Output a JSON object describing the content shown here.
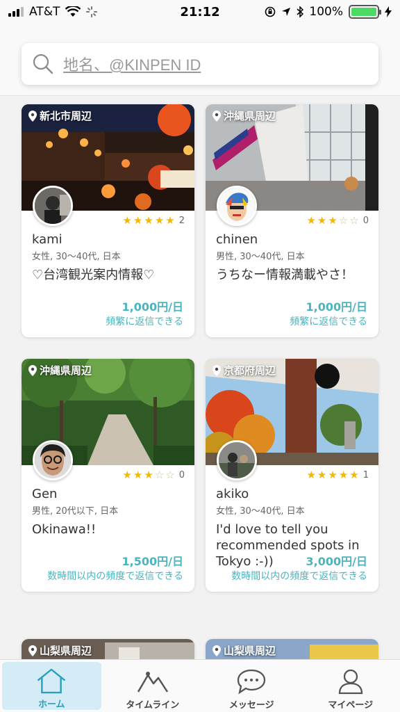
{
  "status_bar": {
    "carrier": "AT&T",
    "time": "21:12",
    "battery_percent": "100%",
    "battery_level": 1.0
  },
  "search": {
    "placeholder": "地名、@KINPEN ID"
  },
  "cards": [
    {
      "area": "新北市周辺",
      "stars": 5,
      "review_count": "2",
      "name": "kami",
      "meta": "女性, 30〜40代, 日本",
      "catch": "♡台湾観光案内情報♡",
      "price": "1,000円/日",
      "reply": "頻繁に返信できる"
    },
    {
      "area": "沖縄県周辺",
      "stars": 3,
      "review_count": "0",
      "name": "chinen",
      "meta": "男性, 30〜40代, 日本",
      "catch": "うちなー情報満載やさ！",
      "price": "1,000円/日",
      "reply": "頻繁に返信できる"
    },
    {
      "area": "沖縄県周辺",
      "stars": 3,
      "review_count": "0",
      "name": "Gen",
      "meta": "男性, 20代以下, 日本",
      "catch": "Okinawa!!",
      "price": "1,500円/日",
      "reply": "数時間以内の頻度で返信できる"
    },
    {
      "area": "京都府周辺",
      "stars": 5,
      "review_count": "1",
      "name": "akiko",
      "meta": "女性, 30〜40代, 日本",
      "catch": "I'd love to tell you recommended spots in Tokyo :-))",
      "price": "3,000円/日",
      "reply": "数時間以内の頻度で返信できる"
    },
    {
      "area": "山梨県周辺"
    },
    {
      "area": "山梨県周辺"
    }
  ],
  "tabs": [
    {
      "label": "ホーム",
      "icon": "home-icon",
      "active": true
    },
    {
      "label": "タイムライン",
      "icon": "mountain-icon",
      "active": false
    },
    {
      "label": "メッセージ",
      "icon": "chat-bubble-icon",
      "active": false
    },
    {
      "label": "マイページ",
      "icon": "person-icon",
      "active": false
    }
  ],
  "colors": {
    "accent": "#4ab4bf",
    "star": "#f5b800",
    "active_tab_bg": "#d3ecf5"
  }
}
